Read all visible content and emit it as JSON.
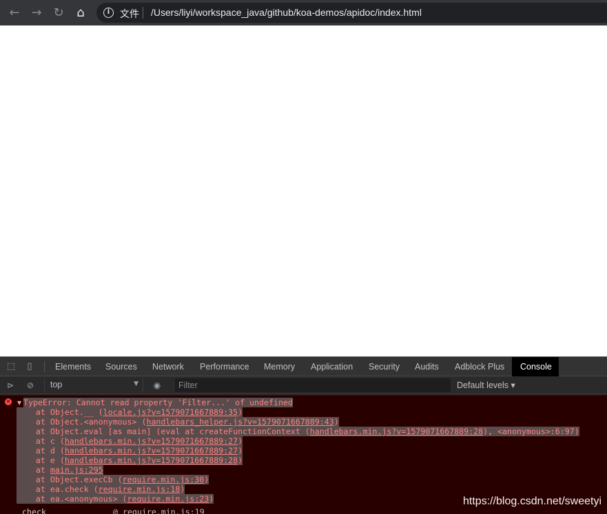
{
  "browser": {
    "back_icon": "arrow-left-icon",
    "forward_icon": "arrow-right-icon",
    "reload_icon": "reload-icon",
    "home_icon": "home-icon",
    "info_icon": "info-icon",
    "file_label": "文件",
    "url": "/Users/liyi/workspace_java/github/koa-demos/apidoc/index.html"
  },
  "devtools": {
    "tabs": [
      "Elements",
      "Sources",
      "Network",
      "Performance",
      "Memory",
      "Application",
      "Security",
      "Audits",
      "Adblock Plus",
      "Console"
    ],
    "active_tab": "Console",
    "context": "top",
    "filter_placeholder": "Filter",
    "levels": "Default levels ▾"
  },
  "console": {
    "error_title": "TypeError: Cannot read property 'Filter...' of undefined",
    "stack": [
      {
        "pre": "    at Object.__ (",
        "link": "locale.js?v=1579071667889:35",
        "post": ")"
      },
      {
        "pre": "    at Object.<anonymous> (",
        "link": "handlebars_helper.js?v=1579071667889:43",
        "post": ")"
      },
      {
        "pre": "    at Object.eval [as main] (eval at createFunctionContext (",
        "link": "handlebars.min.js?v=1579071667889:28",
        "post": "), <anonymous>:6:97)"
      },
      {
        "pre": "    at c (",
        "link": "handlebars.min.js?v=1579071667889:27",
        "post": ")"
      },
      {
        "pre": "    at d (",
        "link": "handlebars.min.js?v=1579071667889:27",
        "post": ")"
      },
      {
        "pre": "    at e (",
        "link": "handlebars.min.js?v=1579071667889:28",
        "post": ")"
      },
      {
        "pre": "    at ",
        "link": "main.js:295",
        "post": ""
      },
      {
        "pre": "    at Object.execCb (",
        "link": "require.min.js:30",
        "post": ")"
      },
      {
        "pre": "    at ea.check (",
        "link": "require.min.js:18",
        "post": ")"
      },
      {
        "pre": "    at ea.<anonymous> (",
        "link": "require.min.js:23",
        "post": ")"
      }
    ],
    "tail_name": "check",
    "tail_source": "@ require.min.js:19"
  },
  "watermark": "https://blog.csdn.net/sweetyi"
}
